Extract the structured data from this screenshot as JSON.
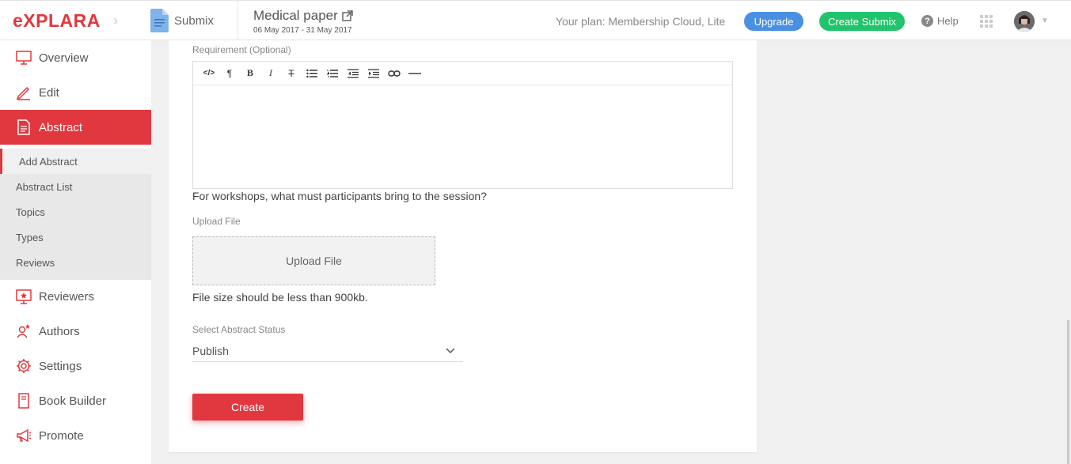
{
  "header": {
    "logo": "eXPLARA",
    "app_name": "Submix",
    "event_title": "Medical paper",
    "event_dates": "06 May 2017 - 31 May 2017",
    "plan_text": "Your plan: Membership Cloud, Lite",
    "upgrade_label": "Upgrade",
    "create_submix_label": "Create Submix",
    "help_label": "Help"
  },
  "sidebar": {
    "items": [
      {
        "label": "Overview",
        "icon": "monitor-icon"
      },
      {
        "label": "Edit",
        "icon": "pencil-icon"
      },
      {
        "label": "Abstract",
        "icon": "document-icon"
      },
      {
        "label": "Reviewers",
        "icon": "reviewer-icon"
      },
      {
        "label": "Authors",
        "icon": "author-icon"
      },
      {
        "label": "Settings",
        "icon": "gear-icon"
      },
      {
        "label": "Book Builder",
        "icon": "book-icon"
      },
      {
        "label": "Promote",
        "icon": "megaphone-icon"
      }
    ],
    "sub_items": [
      "Add Abstract",
      "Abstract List",
      "Topics",
      "Types",
      "Reviews"
    ]
  },
  "form": {
    "requirement_label": "Requirement (Optional)",
    "toolbar": [
      "</>",
      "¶",
      "B",
      "I",
      "T",
      "ul",
      "ol",
      "outdent",
      "indent",
      "link",
      "hr"
    ],
    "question": "For workshops, what must participants bring to the session?",
    "upload_label": "Upload File",
    "upload_button": "Upload File",
    "file_size_note": "File size should be less than 900kb.",
    "status_label": "Select Abstract Status",
    "status_value": "Publish",
    "create_label": "Create"
  },
  "colors": {
    "brand": "#e0383e",
    "upgrade": "#4a90e2",
    "create_submix": "#21c46b"
  }
}
